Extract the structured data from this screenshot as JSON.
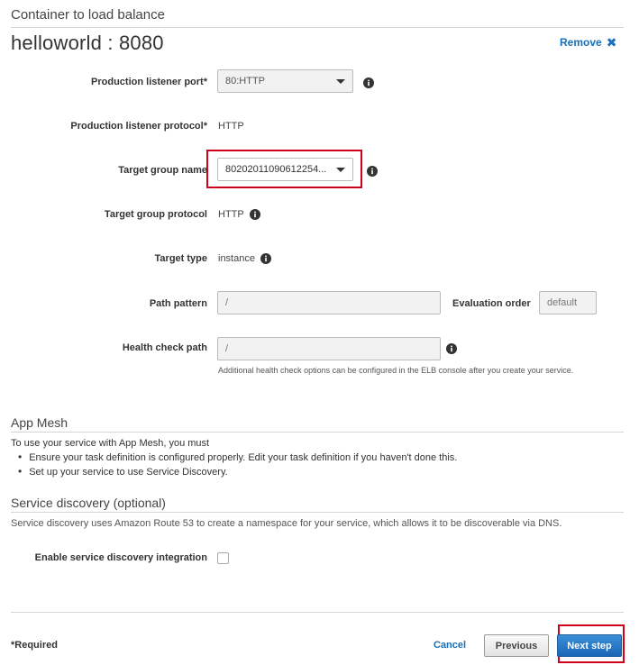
{
  "container_section": {
    "title": "Container to load balance",
    "container_name": "helloworld : 8080",
    "remove_label": "Remove"
  },
  "form": {
    "production_listener_port": {
      "label": "Production listener port*",
      "value": "80:HTTP"
    },
    "production_listener_protocol": {
      "label": "Production listener protocol*",
      "value": "HTTP"
    },
    "target_group_name": {
      "label": "Target group name",
      "value": "80202011090612254..."
    },
    "target_group_protocol": {
      "label": "Target group protocol",
      "value": "HTTP"
    },
    "target_type": {
      "label": "Target type",
      "value": "instance"
    },
    "path_pattern": {
      "label": "Path pattern",
      "value": "/"
    },
    "evaluation_order": {
      "label": "Evaluation order",
      "value": "default"
    },
    "health_check_path": {
      "label": "Health check path",
      "value": "/",
      "help": "Additional health check options can be configured in the ELB console after you create your service."
    }
  },
  "app_mesh": {
    "title": "App Mesh",
    "intro": "To use your service with App Mesh, you must",
    "items": [
      "Ensure your task definition is configured properly. Edit your task definition if you haven't done this.",
      "Set up your service to use Service Discovery."
    ]
  },
  "service_discovery": {
    "title": "Service discovery (optional)",
    "description": "Service discovery uses Amazon Route 53 to create a namespace for your service, which allows it to be discoverable via DNS.",
    "enable_label": "Enable service discovery integration",
    "enabled": false
  },
  "footer": {
    "required_note": "*Required",
    "cancel_label": "Cancel",
    "previous_label": "Previous",
    "next_label": "Next step"
  },
  "colors": {
    "link": "#1a6fb8",
    "primary_button": "#1a66b5",
    "highlight": "#d0021b"
  }
}
